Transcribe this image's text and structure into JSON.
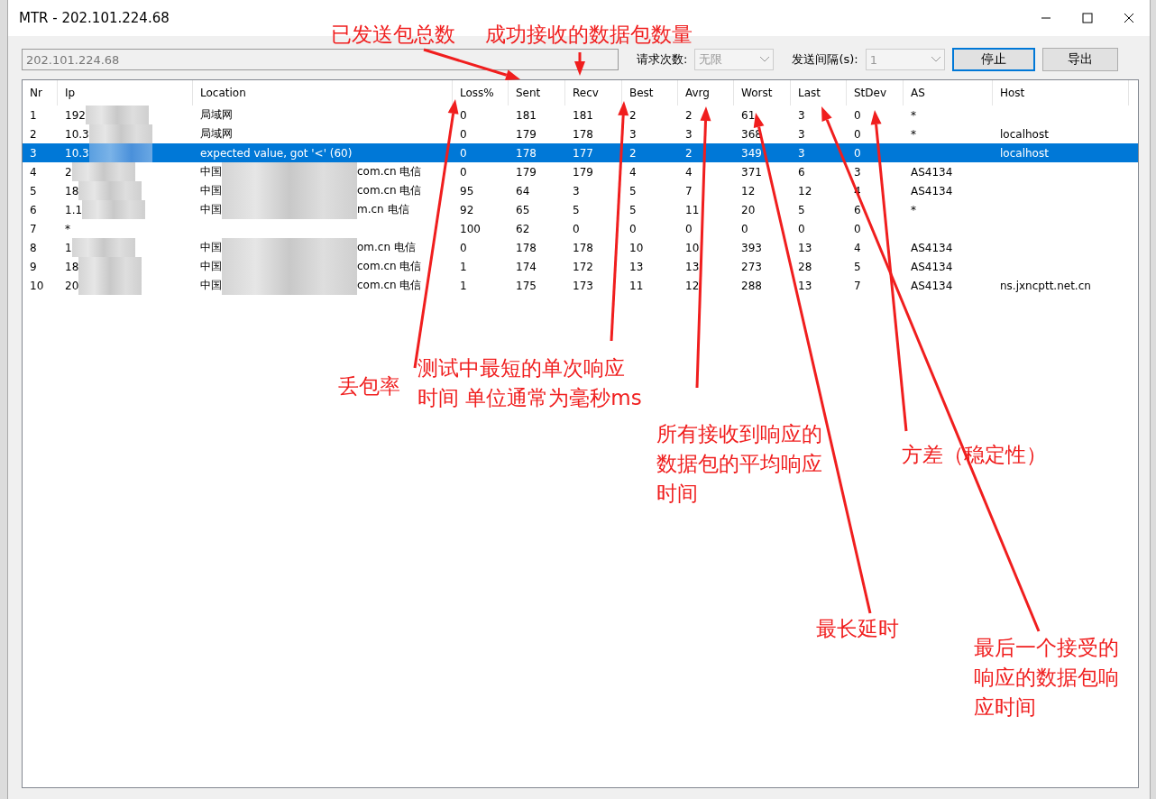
{
  "window": {
    "title": "MTR - 202.101.224.68"
  },
  "toolbar": {
    "target": {
      "value": "202.101.224.68"
    },
    "request_count": {
      "label": "请求次数:",
      "value": "无限"
    },
    "interval": {
      "label": "发送间隔(s):",
      "value": "1"
    },
    "buttons": [
      {
        "label": "停止",
        "focused": true
      },
      {
        "label": "导出",
        "focused": false
      }
    ]
  },
  "table": {
    "columns": [
      "Nr",
      "Ip",
      "Location",
      "Loss%",
      "Sent",
      "Recv",
      "Best",
      "Avrg",
      "Worst",
      "Last",
      "StDev",
      "AS",
      "Host"
    ],
    "rows": [
      {
        "selected": false,
        "nr": "1",
        "ip": "192",
        "ip_blurred": true,
        "location": "局域网",
        "location_blurred": false,
        "loss": "0",
        "sent": "181",
        "recv": "181",
        "best": "2",
        "avrg": "2",
        "worst": "61",
        "last": "3",
        "stdev": "0",
        "as": "*"
      },
      {
        "selected": false,
        "nr": "2",
        "ip": "10.3",
        "ip_blurred": true,
        "location": "局域网",
        "location_blurred": false,
        "loss": "0",
        "sent": "179",
        "recv": "178",
        "best": "3",
        "avrg": "3",
        "worst": "368",
        "last": "3",
        "stdev": "0",
        "as": "*",
        "host": "localhost"
      },
      {
        "selected": true,
        "nr": "3",
        "ip": "10.3",
        "ip_blurred": true,
        "location": "expected value, got '<' (60)",
        "location_blurred": false,
        "loss": "0",
        "sent": "178",
        "recv": "177",
        "best": "2",
        "avrg": "2",
        "worst": "349",
        "last": "3",
        "stdev": "0",
        "host": "localhost"
      },
      {
        "selected": false,
        "nr": "4",
        "ip": "2",
        "ip_blurred": true,
        "location": "中国",
        "location_blurred": true,
        "location_tail": "com.cn 电信",
        "loss": "0",
        "sent": "179",
        "recv": "179",
        "best": "4",
        "avrg": "4",
        "worst": "371",
        "last": "6",
        "stdev": "3",
        "as": "AS4134"
      },
      {
        "selected": false,
        "nr": "5",
        "ip": "18",
        "ip_blurred": true,
        "location": "中国",
        "location_blurred": true,
        "location_tail": "com.cn 电信",
        "loss": "95",
        "sent": "64",
        "recv": "3",
        "best": "5",
        "avrg": "7",
        "worst": "12",
        "last": "12",
        "stdev": "4",
        "as": "AS4134"
      },
      {
        "selected": false,
        "nr": "6",
        "ip": "1.1",
        "ip_blurred": true,
        "location": "中国",
        "location_blurred": true,
        "location_tail": "m.cn 电信",
        "loss": "92",
        "sent": "65",
        "recv": "5",
        "best": "5",
        "avrg": "11",
        "worst": "20",
        "last": "5",
        "stdev": "6",
        "as": "*"
      },
      {
        "selected": false,
        "nr": "7",
        "ip": "*",
        "ip_blurred": false,
        "location_blurred": false,
        "loss": "100",
        "sent": "62",
        "recv": "0",
        "best": "0",
        "avrg": "0",
        "worst": "0",
        "last": "0",
        "stdev": "0"
      },
      {
        "selected": false,
        "nr": "8",
        "ip": "1",
        "ip_blurred": true,
        "location": "中国",
        "location_blurred": true,
        "location_tail": "om.cn 电信",
        "loss": "0",
        "sent": "178",
        "recv": "178",
        "best": "10",
        "avrg": "10",
        "worst": "393",
        "last": "13",
        "stdev": "4",
        "as": "AS4134"
      },
      {
        "selected": false,
        "nr": "9",
        "ip": "18",
        "ip_blurred": true,
        "location": "中国",
        "location_blurred": true,
        "location_tail": "com.cn 电信",
        "loss": "1",
        "sent": "174",
        "recv": "172",
        "best": "13",
        "avrg": "13",
        "worst": "273",
        "last": "28",
        "stdev": "5",
        "as": "AS4134"
      },
      {
        "selected": false,
        "nr": "10",
        "ip": "20",
        "ip_blurred": true,
        "location": "中国",
        "location_blurred": true,
        "location_tail": "com.cn 电信",
        "loss": "1",
        "sent": "175",
        "recv": "173",
        "best": "11",
        "avrg": "12",
        "worst": "288",
        "last": "13",
        "stdev": "7",
        "as": "AS4134",
        "host": "ns.jxncptt.net.cn"
      }
    ]
  },
  "annotations": [
    {
      "lines": [
        "已发送包总数"
      ]
    },
    {
      "lines": [
        "成功接收的数据包数量"
      ]
    },
    {
      "lines": [
        "丢包率"
      ]
    },
    {
      "lines": [
        "测试中最短的单次响应",
        "时间 单位通常为毫秒ms"
      ]
    },
    {
      "lines": [
        "所有接收到响应的",
        "数据包的平均响应",
        "时间"
      ]
    },
    {
      "lines": [
        "方差（稳定性）"
      ]
    },
    {
      "lines": [
        "最长延时"
      ]
    },
    {
      "lines": [
        "最后一个接受的",
        "响应的数据包响",
        "应时间"
      ]
    }
  ]
}
